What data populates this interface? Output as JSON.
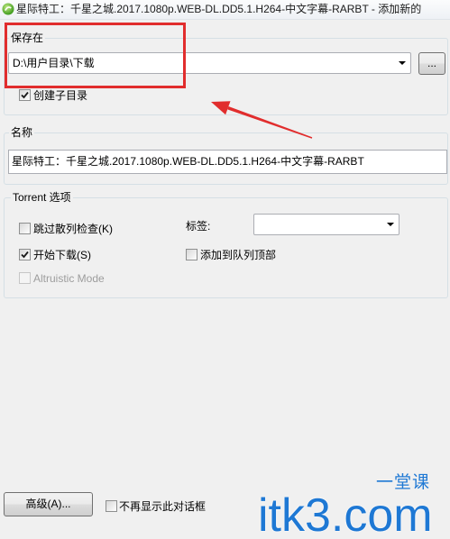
{
  "window": {
    "title": "星际特工：千星之城.2017.1080p.WEB-DL.DD5.1.H264-中文字幕-RARBT - 添加新的",
    "app_icon": "qbittorrent-icon"
  },
  "save_location": {
    "group_title": "保存在",
    "path_value": "D:\\用户目录\\下载",
    "browse_button": "...",
    "create_subfolder": {
      "label": "创建子目录",
      "checked": true
    }
  },
  "name_section": {
    "group_title": "名称",
    "value": "星际特工：千星之城.2017.1080p.WEB-DL.DD5.1.H264-中文字幕-RARBT"
  },
  "torrent_options": {
    "group_title": "Torrent 选项",
    "skip_hash_check": {
      "label": "跳过散列检查(K)",
      "checked": false
    },
    "tag": {
      "label": "标签:",
      "value": ""
    },
    "start_download": {
      "label": "开始下载(S)",
      "checked": true
    },
    "add_to_top_of_queue": {
      "label": "添加到队列顶部",
      "checked": false
    },
    "altruistic_mode": {
      "label": "Altruistic Mode",
      "checked": false,
      "enabled": false
    }
  },
  "footer": {
    "advanced_button": "高级(A)...",
    "dont_show_again": {
      "label": "不再显示此对话框",
      "checked": false
    }
  },
  "watermark": {
    "brand": "一堂课",
    "site": "itk3.com"
  },
  "colors": {
    "annotation_red": "#e12d2d",
    "watermark_blue": "#1e78d4"
  }
}
